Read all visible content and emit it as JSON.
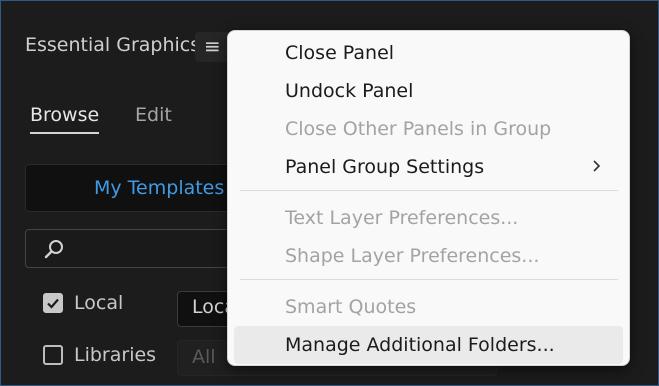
{
  "panel": {
    "title": "Essential Graphics",
    "menu_icon": "hamburger-menu-icon",
    "tabs": [
      {
        "label": "Browse",
        "active": true
      },
      {
        "label": "Edit",
        "active": false
      }
    ],
    "templates_label": "My Templates",
    "search": {
      "icon": "search-icon",
      "value": ""
    },
    "sources": [
      {
        "label": "Local",
        "checked": true,
        "select_value": "Local"
      },
      {
        "label": "Libraries",
        "checked": false,
        "select_value": "All"
      }
    ],
    "colors": {
      "accent": "#3f9be6",
      "border": "#2f5a85"
    }
  },
  "context_menu": {
    "items": [
      {
        "label": "Close Panel",
        "enabled": true
      },
      {
        "label": "Undock Panel",
        "enabled": true
      },
      {
        "label": "Close Other Panels in Group",
        "enabled": false
      },
      {
        "label": "Panel Group Settings",
        "enabled": true,
        "submenu_icon": "chevron-right-icon"
      },
      {
        "label": "Text Layer Preferences...",
        "enabled": false
      },
      {
        "label": "Shape Layer Preferences...",
        "enabled": false
      },
      {
        "label": "Smart Quotes",
        "enabled": false
      },
      {
        "label": "Manage Additional Folders...",
        "enabled": true,
        "hovered": true
      }
    ]
  }
}
